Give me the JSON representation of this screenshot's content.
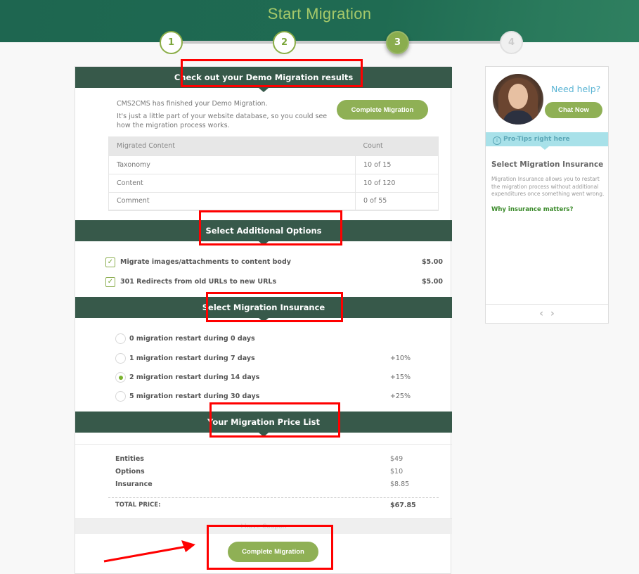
{
  "header": {
    "title": "Start Migration",
    "steps": [
      "1",
      "2",
      "3",
      "4"
    ],
    "active_step": 3
  },
  "demo_results": {
    "heading": "Check out your Demo Migration results",
    "intro_line1": "CMS2CMS has finished your Demo Migration.",
    "intro_line2": "It's just a little part of your website database, so you could see how the migration process works.",
    "complete_button": "Complete Migration",
    "table": {
      "headers": [
        "Migrated Content",
        "Count"
      ],
      "rows": [
        {
          "content": "Taxonomy",
          "count": "10 of 15"
        },
        {
          "content": "Content",
          "count": "10 of 120"
        },
        {
          "content": "Comment",
          "count": "0 of 55"
        }
      ]
    }
  },
  "additional_options": {
    "heading": "Select Additional Options",
    "items": [
      {
        "label": "Migrate images/attachments to content body",
        "price": "$5.00",
        "checked": true
      },
      {
        "label": "301 Redirects from old URLs to new URLs",
        "price": "$5.00",
        "checked": true
      }
    ]
  },
  "insurance": {
    "heading": "Select Migration Insurance",
    "options": [
      {
        "label": "0 migration restart during 0 days",
        "percent": "",
        "selected": false
      },
      {
        "label": "1 migration restart during 7 days",
        "percent": "+10%",
        "selected": false
      },
      {
        "label": "2 migration restart during 14 days",
        "percent": "+15%",
        "selected": true
      },
      {
        "label": "5 migration restart during 30 days",
        "percent": "+25%",
        "selected": false
      }
    ]
  },
  "price_list": {
    "heading": "Your Migration Price List",
    "rows": [
      {
        "label": "Entities",
        "value": "$49"
      },
      {
        "label": "Options",
        "value": "$10"
      },
      {
        "label": "Insurance",
        "value": "$8.85"
      }
    ],
    "total_label": "TOTAL PRICE:",
    "total_value": "$67.85",
    "coupon_label": "I have Coupon",
    "complete_button": "Complete Migration"
  },
  "sidebar": {
    "need_help": "Need help?",
    "chat_button": "Chat Now",
    "tips_label": "Pro-Tips right here",
    "tip_title": "Select Migration Insurance",
    "tip_text": "Migration Insurance allows you to restart the migration process without additional expenditures once something went wrong.",
    "tip_link": "Why insurance matters?",
    "prev_glyph": "‹",
    "next_glyph": "›"
  },
  "colors": {
    "header_bg": "#1f6b52",
    "section_bg": "#37594a",
    "accent_green": "#8fb055",
    "help_blue": "#5ab4d4",
    "tips_bg": "#a8e1e9",
    "annotation_red": "#ff0000"
  }
}
